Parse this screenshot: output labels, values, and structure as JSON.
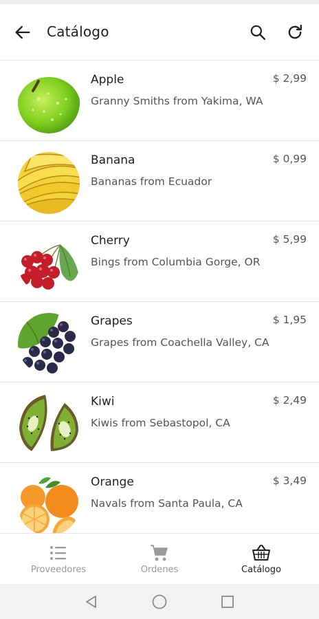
{
  "app_bar": {
    "title": "Catálogo",
    "back_icon": "arrow-left-icon",
    "search_icon": "search-icon",
    "refresh_icon": "refresh-icon"
  },
  "products": [
    {
      "name": "Apple",
      "description": "Granny Smiths from Yakima, WA",
      "price": "$ 2,99",
      "image": "apple-image"
    },
    {
      "name": "Banana",
      "description": "Bananas from Ecuador",
      "price": "$ 0,99",
      "image": "banana-image"
    },
    {
      "name": "Cherry",
      "description": "Bings from Columbia Gorge, OR",
      "price": "$ 5,99",
      "image": "cherry-image"
    },
    {
      "name": "Grapes",
      "description": "Grapes from Coachella Valley, CA",
      "price": "$ 1,95",
      "image": "grapes-image"
    },
    {
      "name": "Kiwi",
      "description": "Kiwis from Sebastopol, CA",
      "price": "$ 2,49",
      "image": "kiwi-image"
    },
    {
      "name": "Orange",
      "description": "Navals from Santa Paula, CA",
      "price": "$ 3,49",
      "image": "orange-image"
    }
  ],
  "bottom_nav": {
    "items": [
      {
        "label": "Proveedores",
        "icon": "list-icon",
        "active": false
      },
      {
        "label": "Ordenes",
        "icon": "cart-icon",
        "active": false
      },
      {
        "label": "Catálogo",
        "icon": "basket-icon",
        "active": true
      }
    ]
  },
  "system_nav": [
    "back-triangle-icon",
    "home-circle-icon",
    "recents-square-icon"
  ],
  "colors": {
    "text": "#1f1f1f",
    "secondary_text": "#555555",
    "inactive_nav": "#9a9a9a",
    "divider": "#e2e2e2"
  }
}
